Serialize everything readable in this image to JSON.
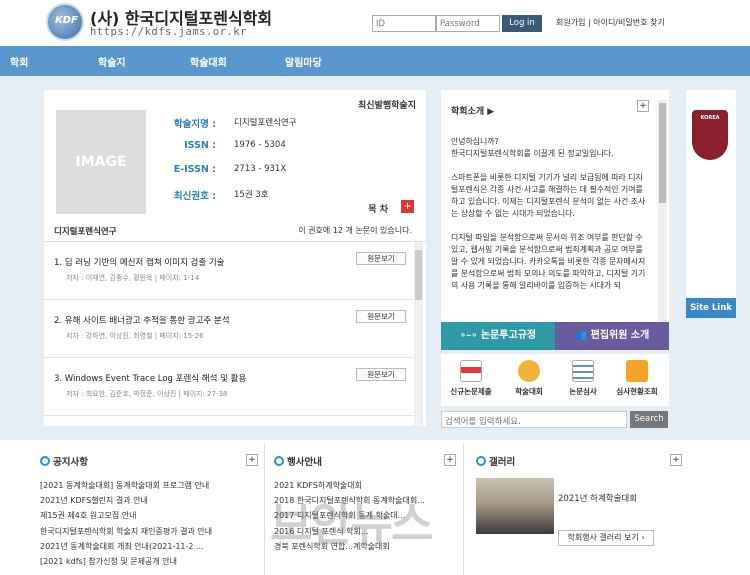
{
  "header": {
    "logo_text": "KDF",
    "title": "(사) 한국디지털포렌식학회",
    "url": "https://kdfs.jams.or.kr",
    "login": {
      "id_placeholder": "ID",
      "pw_placeholder": "Password",
      "button": "Log in"
    },
    "top_links": "회원가입 | 아이디/비밀번호 찾기"
  },
  "nav": {
    "items": [
      "학회",
      "학술지",
      "학술대회",
      "알림마당"
    ]
  },
  "journal": {
    "section_title": "최신발행학술지",
    "image_label": "IMAGE",
    "fields": [
      {
        "label": "학술지명 :",
        "value": "디지털포렌식연구"
      },
      {
        "label": "ISSN :",
        "value": "1976 - 5304"
      },
      {
        "label": "E-ISSN :",
        "value": "2713 - 931X"
      },
      {
        "label": "최신권호 :",
        "value": "15권  3호"
      }
    ],
    "toc_label": "목 차",
    "toc_plus": "+",
    "list_head_title": "디지털포렌식연구",
    "list_head_count": "이 권호에 12 개 논문이 있습니다.",
    "view_label": "원문보기",
    "papers": [
      {
        "title": "1. 딥 러닝 기반의 메신저 캡쳐 이미지 검출 기술",
        "meta": "저자 : 이재연, 김중수, 황원욱 | 페이지: 1-14"
      },
      {
        "title": "2. 유해 사이트 배너광고 추적을 통한 광고주 분석",
        "meta": "저자 : 강하연, 이상진, 최영철 | 페이지: 15-26"
      },
      {
        "title": "3. Windows Event Trace Log 포렌식 해석 및 활용",
        "meta": "저자 : 최요한, 김준호, 박정준, 이상진 | 페이지: 27-38"
      }
    ]
  },
  "about": {
    "title": "학회소개 ▶",
    "plus": "+",
    "paragraphs": [
      "안녕하십니까?\n한국디지털포렌식학회를 이끌게 된 정교일입니다.",
      "스마트폰을 비롯한 디지털 기기가 널리 보급됨에 따라 디지털포렌식은 각종 사건·사고를 해결하는 데 필수적인 기여를 하고 있습니다. 이제는 디지털포렌식 분석이 없는 사건 조사는 상상할 수 없는 시대가 되었습니다.",
      "디지털 파일을 분석함으로써 문서의 위조 여부를 판단할 수 있고, 웹서핑 기록을 분석함으로써 범죄계획과 공모 여부를 알 수 있게 되었습니다. 카카오톡을 비롯한 각종 문자메시지를 분석함으로써 범죄 모의나 의도를 파악하고, 디지털 기기의 사용 기록을 통해 알리바이를 입증하는 시대가 되"
    ]
  },
  "buttons": {
    "submit": "논문투고규정",
    "editor": "편집위원 소개"
  },
  "quick": [
    "신규논문제출",
    "학술대회",
    "논문심사",
    "심사현황조회"
  ],
  "search": {
    "placeholder": "검색어를 입력하세요.",
    "button": "Search"
  },
  "sitelink": {
    "logo": "KOREA",
    "label": "Site Link"
  },
  "notices": {
    "title": "공지사항",
    "plus": "+",
    "items": [
      "[2021 동계학술대회] 동계학술대회 프로그램 안내",
      "2021년 KDFS챌린지 결과 안내",
      "제15권 제4호 원고모집 안내",
      "한국디지털포렌식학회 학술지 재인증평가 결과 안내",
      "2021년 동계학술대회 개최 안내(2021-11-2 ...",
      "[2021 kdfs] 참가신청 및 문제공개 안내"
    ]
  },
  "events": {
    "title": "행사안내",
    "plus": "+",
    "items": [
      "2021 KDFS하계학술대회",
      "2018 한국디지털포렌식학회 동계학술대회...",
      "2017 디지털포렌식학회 동계 학술대...",
      "2016 디지털 포렌식 학회...",
      "경북 포렌식학회 연합...계학술대회"
    ]
  },
  "gallery": {
    "title": "갤러리",
    "plus": "+",
    "caption": "2021년 하계학술대회",
    "button": "학회행사 갤러리 보기 ›"
  },
  "watermark": "보안뉴스"
}
